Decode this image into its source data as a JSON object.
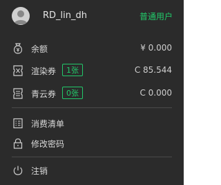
{
  "user": {
    "name": "RD_lin_dh",
    "type": "普通用户"
  },
  "wallet": {
    "balance": {
      "label": "余额",
      "value": "¥ 0.000",
      "icon": "wallet-icon"
    },
    "render_coupon": {
      "label": "渲染券",
      "badge": "1张",
      "value": "C 85.544",
      "icon": "render-coupon-icon"
    },
    "qingyun_coupon": {
      "label": "青云券",
      "badge": "0张",
      "value": "C 0.000",
      "icon": "cloud-coupon-icon"
    }
  },
  "menu": {
    "bill": {
      "label": "消费清单",
      "icon": "bill-icon"
    },
    "password": {
      "label": "修改密码",
      "icon": "lock-icon"
    },
    "logout": {
      "label": "注销",
      "icon": "power-icon"
    }
  },
  "colors": {
    "background": "#2b2b2b",
    "accent": "#22c96a",
    "text": "#d9d9d9",
    "divider": "#4a4a4a"
  }
}
